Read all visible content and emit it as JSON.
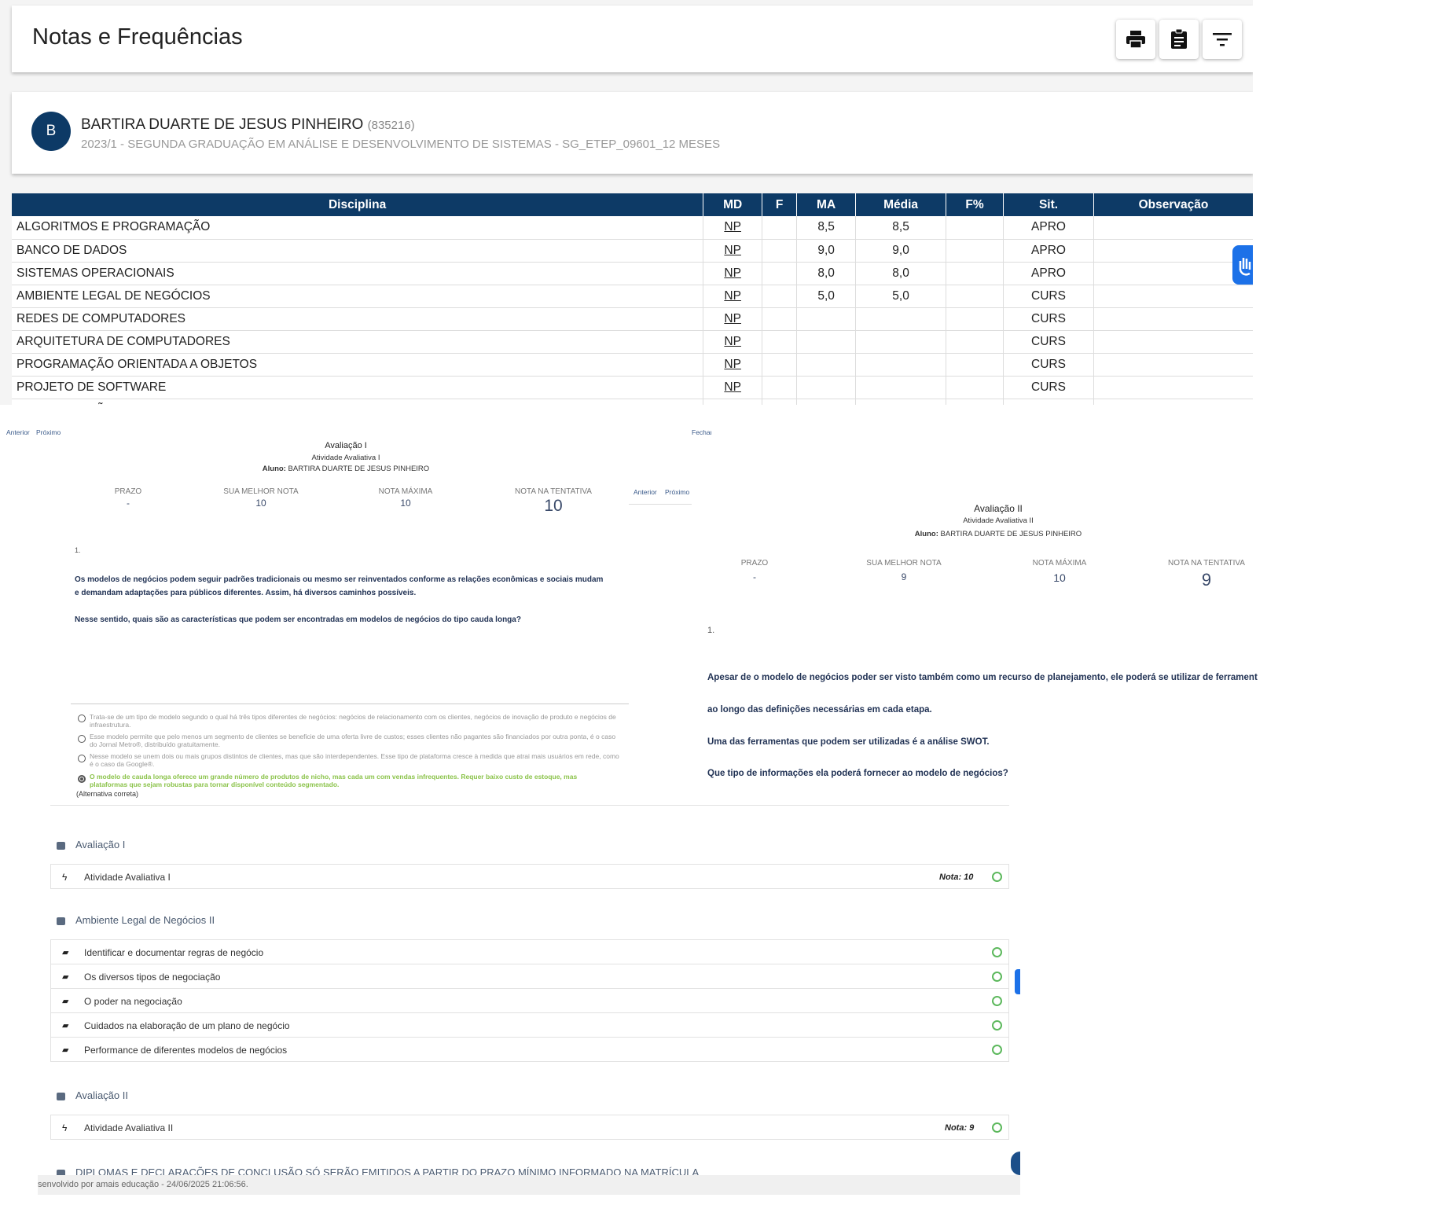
{
  "header": {
    "title": "Notas e Frequências",
    "buttons": [
      {
        "name": "print",
        "icon": "print-icon"
      },
      {
        "name": "report",
        "icon": "clipboard-icon"
      },
      {
        "name": "filter",
        "icon": "filter-icon"
      }
    ]
  },
  "student": {
    "initial": "B",
    "name": "BARTIRA DUARTE DE JESUS PINHEIRO",
    "id": "(835216)",
    "course": "2023/1 - SEGUNDA GRADUAÇÃO EM ANÁLISE E DESENVOLVIMENTO DE SISTEMAS - SG_ETEP_09601_12 MESES"
  },
  "table": {
    "headers": [
      "Disciplina",
      "MD",
      "F",
      "MA",
      "Média",
      "F%",
      "Sit.",
      "Observação"
    ],
    "rows": [
      {
        "disc": "ALGORITMOS E PROGRAMAÇÃO",
        "md": "NP",
        "f": "",
        "ma": "8,5",
        "media": "8,5",
        "fp": "",
        "sit": "APRO",
        "obs": ""
      },
      {
        "disc": "BANCO DE DADOS",
        "md": "NP",
        "f": "",
        "ma": "9,0",
        "media": "9,0",
        "fp": "",
        "sit": "APRO",
        "obs": ""
      },
      {
        "disc": "SISTEMAS OPERACIONAIS",
        "md": "NP",
        "f": "",
        "ma": "8,0",
        "media": "8,0",
        "fp": "",
        "sit": "APRO",
        "obs": ""
      },
      {
        "disc": "AMBIENTE LEGAL DE NEGÓCIOS",
        "md": "NP",
        "f": "",
        "ma": "5,0",
        "media": "5,0",
        "fp": "",
        "sit": "CURS",
        "obs": ""
      },
      {
        "disc": "REDES DE COMPUTADORES",
        "md": "NP",
        "f": "",
        "ma": "",
        "media": "",
        "fp": "",
        "sit": "CURS",
        "obs": ""
      },
      {
        "disc": "ARQUITETURA DE COMPUTADORES",
        "md": "NP",
        "f": "",
        "ma": "",
        "media": "",
        "fp": "",
        "sit": "CURS",
        "obs": ""
      },
      {
        "disc": "PROGRAMAÇÃO ORIENTADA A OBJETOS",
        "md": "NP",
        "f": "",
        "ma": "",
        "media": "",
        "fp": "",
        "sit": "CURS",
        "obs": ""
      },
      {
        "disc": "PROJETO DE SOFTWARE",
        "md": "NP",
        "f": "",
        "ma": "",
        "media": "",
        "fp": "",
        "sit": "CURS",
        "obs": ""
      },
      {
        "disc": "PROGRAMAÇÃO PARA INTERNET",
        "md": "NP",
        "f": "",
        "ma": "",
        "media": "",
        "fp": "",
        "sit": "CURS",
        "obs": ""
      }
    ]
  },
  "eval1": {
    "nav_prev": "Anterior",
    "nav_next": "Próximo",
    "close": "Fechar",
    "title": "Avaliação I",
    "subtitle": "Atividade Avaliativa I",
    "student_label": "Aluno:",
    "student_name": "BARTIRA DUARTE DE JESUS PINHEIRO",
    "stats": [
      {
        "label": "PRAZO",
        "value": "-"
      },
      {
        "label": "SUA MELHOR NOTA",
        "value": "10"
      },
      {
        "label": "NOTA MÁXIMA",
        "value": "10"
      },
      {
        "label": "NOTA NA TENTATIVA",
        "value": "10"
      }
    ],
    "q_number": "1.",
    "q_para1": "Os modelos de negócios podem seguir padrões tradicionais ou mesmo ser reinventados conforme as relações econômicas e sociais mudam e demandam adaptações para públicos diferentes. Assim, há diversos caminhos possíveis.",
    "q_para2": "Nesse sentido, quais são as características que podem ser encontradas em modelos de negócios do tipo cauda longa?",
    "options": [
      "Trata-se de um tipo de modelo segundo o qual há três tipos diferentes de negócios: negócios de relacionamento com os clientes, negócios de inovação de produto e negócios de infraestrutura.",
      "Esse modelo permite que pelo menos um segmento de clientes se beneficie de uma oferta livre de custos; esses clientes não pagantes são financiados por outra ponta, é o caso do Jornal Metro®, distribuído gratuitamente.",
      "Nesse modelo se unem dois ou mais grupos distintos de clientes, mas que são interdependentes. Esse tipo de plataforma cresce à medida que atrai mais usuários em rede, como é o caso da Google®.",
      "O modelo de cauda longa oferece um grande número de produtos de nicho, mas cada um com vendas infrequentes. Requer baixo custo de estoque, mas plataformas que sejam robustas para tornar disponível conteúdo segmentado."
    ],
    "correct_note": "(Alternativa correta)"
  },
  "eval2": {
    "title": "Avaliação II",
    "subtitle": "Atividade Avaliativa II",
    "student_label": "Aluno:",
    "student_name": "BARTIRA DUARTE DE JESUS PINHEIRO",
    "stats": [
      {
        "label": "PRAZO",
        "value": "-"
      },
      {
        "label": "SUA MELHOR NOTA",
        "value": "9"
      },
      {
        "label": "NOTA MÁXIMA",
        "value": "10"
      },
      {
        "label": "NOTA NA TENTATIVA",
        "value": "9"
      }
    ],
    "q_number": "1.",
    "q_line1": "Apesar de o modelo de negócios poder ser visto também como um recurso de planejamento, ele poderá se utilizar de ferramentas",
    "q_line2": "ao longo das definições necessárias em cada etapa.",
    "q_line3": "Uma das ferramentas que podem ser utilizadas é a análise SWOT.",
    "q_line4": "Que tipo de informações ela poderá fornecer ao modelo de negócios?"
  },
  "modules": {
    "section1": "Avaliação I",
    "item1": "Atividade Avaliativa I",
    "item1_nota": "Nota: 10",
    "section2": "Ambiente Legal de Negócios II",
    "items2": [
      "Identificar e documentar regras de negócio",
      "Os diversos tipos de negociação",
      "O poder na negociação",
      "Cuidados na elaboração de um plano de negócio",
      "Performance de diferentes modelos de negócios"
    ],
    "section3": "Avaliação II",
    "item3": "Atividade Avaliativa II",
    "item3_nota": "Nota: 9",
    "section4": "DIPLOMAS E DECLARAÇÕES DE CONCLUSÃO SÓ SERÃO EMITIDOS A PARTIR DO PRAZO MÍNIMO INFORMADO NA MATRÍCULA",
    "footer": "senvolvido por amais educação - 24/06/2025 21:06:56."
  },
  "colors": {
    "primary": "#0d3a66",
    "accent_blue": "#1c71e8",
    "success": "#5cb85c",
    "correct_option": "#8bc34a"
  }
}
